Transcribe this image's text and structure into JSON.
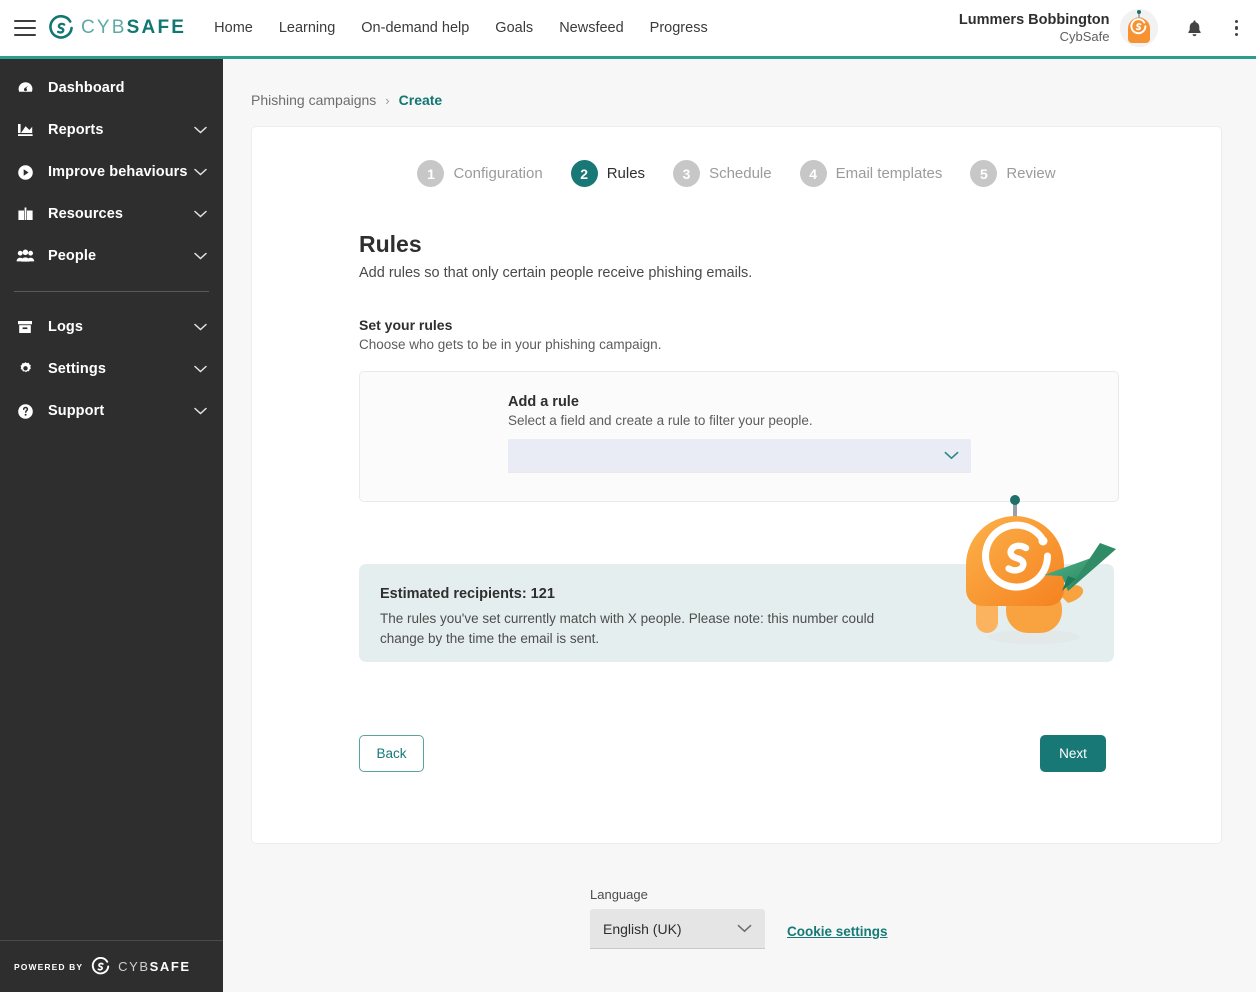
{
  "header": {
    "menu_icon": "hamburger-icon",
    "logo": {
      "part1": "CYB",
      "part2": "SAFE"
    },
    "nav": [
      {
        "label": "Home"
      },
      {
        "label": "Learning"
      },
      {
        "label": "On-demand help"
      },
      {
        "label": "Goals"
      },
      {
        "label": "Newsfeed"
      },
      {
        "label": "Progress"
      }
    ],
    "user": {
      "name": "Lummers Bobbington",
      "org": "CybSafe"
    },
    "notifications_icon": "bell-icon",
    "more_icon": "kebab-menu-icon"
  },
  "sidebar": {
    "items": [
      {
        "label": "Dashboard",
        "icon": "dashboard-icon",
        "expandable": false
      },
      {
        "label": "Reports",
        "icon": "reports-chart-icon",
        "expandable": true
      },
      {
        "label": "Improve behaviours",
        "icon": "play-circle-icon",
        "expandable": true
      },
      {
        "label": "Resources",
        "icon": "book-icon",
        "expandable": true
      },
      {
        "label": "People",
        "icon": "people-icon",
        "expandable": true
      }
    ],
    "items2": [
      {
        "label": "Logs",
        "icon": "archive-box-icon",
        "expandable": true
      },
      {
        "label": "Settings",
        "icon": "gear-icon",
        "expandable": true
      },
      {
        "label": "Support",
        "icon": "help-circle-icon",
        "expandable": true
      }
    ],
    "footer": {
      "powered_by": "POWERED BY",
      "logo_part1": "CYB",
      "logo_part2": "SAFE"
    }
  },
  "breadcrumb": {
    "parent": "Phishing campaigns",
    "separator": "›",
    "current": "Create"
  },
  "stepper": [
    {
      "num": "1",
      "label": "Configuration",
      "active": false
    },
    {
      "num": "2",
      "label": "Rules",
      "active": true
    },
    {
      "num": "3",
      "label": "Schedule",
      "active": false
    },
    {
      "num": "4",
      "label": "Email templates",
      "active": false
    },
    {
      "num": "5",
      "label": "Review",
      "active": false
    }
  ],
  "page": {
    "title": "Rules",
    "subtitle": "Add rules so that only certain people receive phishing emails.",
    "section_title": "Set your rules",
    "section_subtitle": "Choose who gets to be in your phishing campaign."
  },
  "rule_card": {
    "title": "Add a rule",
    "subtitle": "Select a field and create a rule to filter your people.",
    "select_value": "",
    "select_placeholder": "",
    "chevron_icon": "chevron-down-icon"
  },
  "estimate": {
    "title": "Estimated recipients: 121",
    "text": "The rules you've set currently match with X people. Please note: this number could change by the time the email is sent.",
    "illustration": "robot-with-paper-plane-illustration"
  },
  "actions": {
    "back": "Back",
    "next": "Next"
  },
  "footer": {
    "language_label": "Language",
    "language_value": "English (UK)",
    "language_chevron_icon": "chevron-down-icon",
    "cookie_settings": "Cookie settings"
  },
  "colors": {
    "accent_teal": "#187875",
    "header_border": "#2a9d8f",
    "sidebar_bg": "#2e2e2e",
    "page_bg": "#f7f7f7",
    "banner_bg": "#e5eeee",
    "select_bg": "#e9ecf4",
    "robot_orange": "#f79233",
    "plane_green": "#3f9f77"
  }
}
